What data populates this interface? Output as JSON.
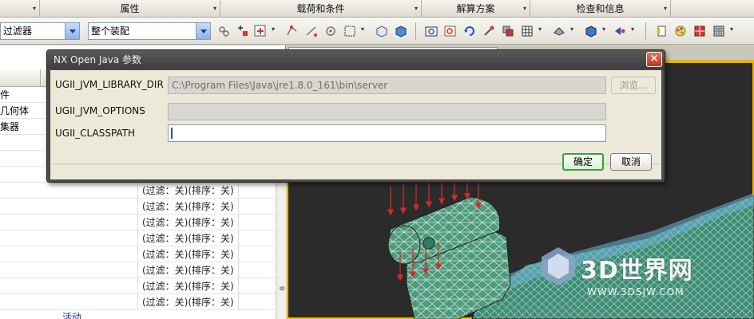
{
  "groups": [
    {
      "label": ""
    },
    {
      "label": "属性"
    },
    {
      "label": "载荷和条件"
    },
    {
      "label": "解算方案"
    },
    {
      "label": "检查和信息"
    }
  ],
  "toolbar": {
    "filter_combo_value": "过滤器",
    "assembly_combo_value": "整个装配"
  },
  "navigator": {
    "rows": [
      {
        "name": "件",
        "value": ""
      },
      {
        "name": "几何体",
        "value": ""
      },
      {
        "name": "集器",
        "value": ""
      },
      {
        "name": "",
        "value": ""
      },
      {
        "name": "",
        "value": ""
      },
      {
        "name": "",
        "value": ""
      },
      {
        "name": "",
        "value": "(过滤：关)(排序：关)"
      },
      {
        "name": "",
        "value": "(过滤：关)(排序：关)"
      },
      {
        "name": "",
        "value": "(过滤：关)(排序：关)"
      },
      {
        "name": "",
        "value": "(过滤：关)(排序：关)"
      },
      {
        "name": "",
        "value": "(过滤：关)(排序：关)"
      },
      {
        "name": "",
        "value": "(过滤：关)(排序：关)"
      },
      {
        "name": "",
        "value": "(过滤：关)(排序：关)"
      },
      {
        "name": "",
        "value": "(过滤：关)(排序：关)"
      }
    ],
    "active_label": "活动"
  },
  "dialog": {
    "title": "NX Open Java 参数",
    "close_glyph": "×",
    "fields": [
      {
        "label": "UGII_JVM_LIBRARY_DIR",
        "value": "C:\\Program Files\\Java\\jre1.8.0_161\\bin\\server"
      },
      {
        "label": "UGII_JVM_OPTIONS",
        "value": ""
      },
      {
        "label": "UGII_CLASSPATH",
        "value": ""
      }
    ],
    "browse_label": "浏览...",
    "ok_label": "确定",
    "cancel_label": "取消"
  },
  "watermark": {
    "brand": "3D世界网",
    "url": "WWW.3DSJW.COM"
  },
  "colors": {
    "model_green": "#4f9a7e",
    "load_arrows": "#d42a2a",
    "viewport_border": "#e8b800",
    "close_button": "#c4311a"
  }
}
